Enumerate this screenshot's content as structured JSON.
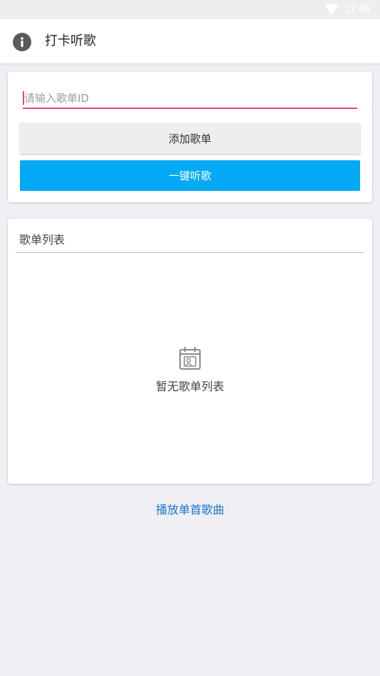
{
  "status_bar": {
    "time": "11:46",
    "wifi_icon": "wifi-icon"
  },
  "app_bar": {
    "icon": "info-icon",
    "title": "打卡听歌"
  },
  "add_card": {
    "input_placeholder": "请输入歌单ID",
    "input_value": "",
    "add_button_label": "添加歌单",
    "listen_button_label": "一键听歌",
    "accent_color": "#e6477a",
    "primary_color": "#03a9f4"
  },
  "list_card": {
    "header": "歌单列表",
    "empty_icon": "empty-playlist-icon",
    "empty_text": "暂无歌单列表"
  },
  "footer": {
    "play_single_label": "播放单首歌曲",
    "link_color": "#1976d2"
  }
}
